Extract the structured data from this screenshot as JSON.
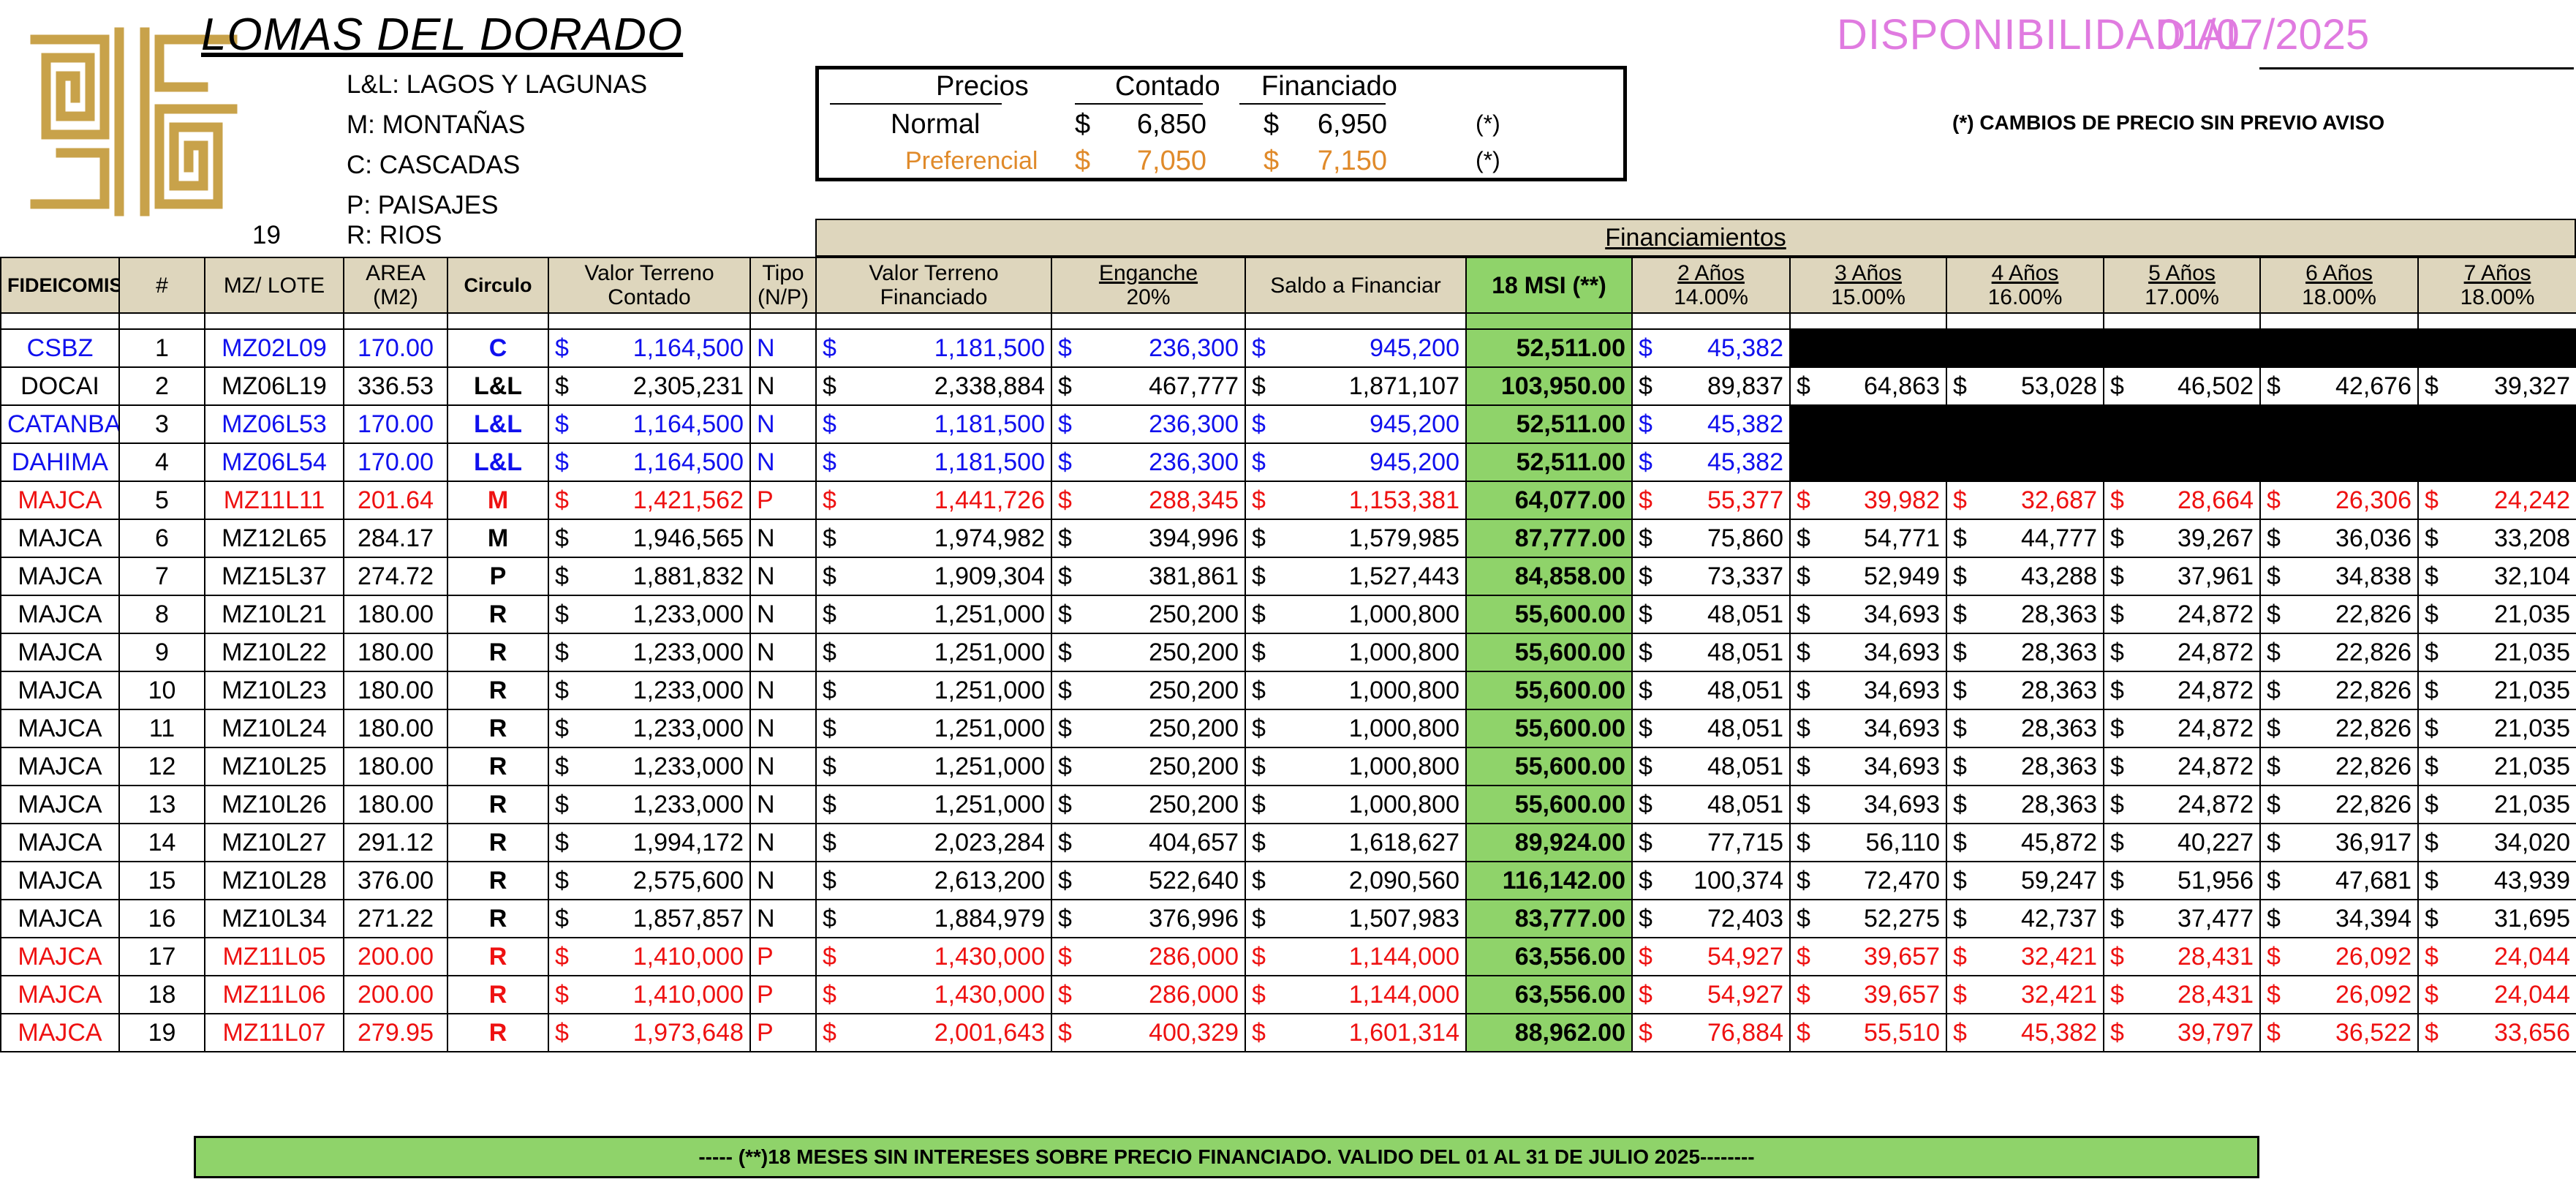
{
  "title": "LOMAS DEL DORADO",
  "legend": [
    "L&L: LAGOS Y LAGUNAS",
    "M: MONTAÑAS",
    "C: CASCADAS",
    "P: PAISAJES",
    "R: RIOS"
  ],
  "lot_count": "19",
  "prices": {
    "col_label": "Precios",
    "col_contado": "Contado",
    "col_financiado": "Financiado",
    "rows": [
      {
        "label": "Normal",
        "contado": "6,850",
        "financiado": "6,950",
        "note": "(*)"
      },
      {
        "label": "Preferencial",
        "contado": "7,050",
        "financiado": "7,150",
        "note": "(*)"
      }
    ],
    "currency": "$"
  },
  "availability": {
    "label": "DISPONIBILIDAD AL",
    "date": "01/07/2025"
  },
  "price_notice": "(*) CAMBIOS DE PRECIO SIN PREVIO AVISO",
  "financing_label": "Financiamientos",
  "colors": {
    "tan": "#ded6bd",
    "green": "#8fd36a",
    "blue": "#1010ee",
    "red": "#ee1111",
    "orange": "#e08a2a",
    "pink": "#e07be0",
    "gold": "#c8a24a"
  },
  "headers": {
    "fideicomiso": "FIDEICOMISO",
    "num": "#",
    "mz_lote": "MZ/ LOTE",
    "area_1": "AREA",
    "area_2": "(M2)",
    "circulo": "Circulo",
    "vt_contado_1": "Valor Terreno",
    "vt_contado_2": "Contado",
    "tipo_1": "Tipo",
    "tipo_2": "(N/P)",
    "vt_fin_1": "Valor Terreno",
    "vt_fin_2": "Financiado",
    "enganche_1": "Enganche",
    "enganche_2": "20%",
    "saldo": "Saldo a Financiar",
    "msi": "18 MSI (**)",
    "years": [
      {
        "label": "2 Años",
        "rate": "14.00%"
      },
      {
        "label": "3 Años",
        "rate": "15.00%"
      },
      {
        "label": "4 Años",
        "rate": "16.00%"
      },
      {
        "label": "5 Años",
        "rate": "17.00%"
      },
      {
        "label": "6 Años",
        "rate": "18.00%"
      },
      {
        "label": "7 Años",
        "rate": "18.00%"
      }
    ]
  },
  "rows": [
    {
      "fid": "CSBZ",
      "n": "1",
      "lote": "MZ02L09",
      "area": "170.00",
      "circ": "C",
      "contado": "1,164,500",
      "tipo": "N",
      "fin": "1,181,500",
      "eng": "236,300",
      "saldo": "945,200",
      "msi": "52,511.00",
      "y": [
        "45,382"
      ],
      "style": "blue"
    },
    {
      "fid": "DOCAI",
      "n": "2",
      "lote": "MZ06L19",
      "area": "336.53",
      "circ": "L&L",
      "contado": "2,305,231",
      "tipo": "N",
      "fin": "2,338,884",
      "eng": "467,777",
      "saldo": "1,871,107",
      "msi": "103,950.00",
      "y": [
        "89,837",
        "64,863",
        "53,028",
        "46,502",
        "42,676",
        "39,327"
      ],
      "style": "normal"
    },
    {
      "fid": "CATANBAR",
      "n": "3",
      "lote": "MZ06L53",
      "area": "170.00",
      "circ": "L&L",
      "contado": "1,164,500",
      "tipo": "N",
      "fin": "1,181,500",
      "eng": "236,300",
      "saldo": "945,200",
      "msi": "52,511.00",
      "y": [
        "45,382"
      ],
      "style": "blue"
    },
    {
      "fid": "DAHIMA",
      "n": "4",
      "lote": "MZ06L54",
      "area": "170.00",
      "circ": "L&L",
      "contado": "1,164,500",
      "tipo": "N",
      "fin": "1,181,500",
      "eng": "236,300",
      "saldo": "945,200",
      "msi": "52,511.00",
      "y": [
        "45,382"
      ],
      "style": "blue"
    },
    {
      "fid": "MAJCA",
      "n": "5",
      "lote": "MZ11L11",
      "area": "201.64",
      "circ": "M",
      "contado": "1,421,562",
      "tipo": "P",
      "fin": "1,441,726",
      "eng": "288,345",
      "saldo": "1,153,381",
      "msi": "64,077.00",
      "y": [
        "55,377",
        "39,982",
        "32,687",
        "28,664",
        "26,306",
        "24,242"
      ],
      "style": "red"
    },
    {
      "fid": "MAJCA",
      "n": "6",
      "lote": "MZ12L65",
      "area": "284.17",
      "circ": "M",
      "contado": "1,946,565",
      "tipo": "N",
      "fin": "1,974,982",
      "eng": "394,996",
      "saldo": "1,579,985",
      "msi": "87,777.00",
      "y": [
        "75,860",
        "54,771",
        "44,777",
        "39,267",
        "36,036",
        "33,208"
      ],
      "style": "normal"
    },
    {
      "fid": "MAJCA",
      "n": "7",
      "lote": "MZ15L37",
      "area": "274.72",
      "circ": "P",
      "contado": "1,881,832",
      "tipo": "N",
      "fin": "1,909,304",
      "eng": "381,861",
      "saldo": "1,527,443",
      "msi": "84,858.00",
      "y": [
        "73,337",
        "52,949",
        "43,288",
        "37,961",
        "34,838",
        "32,104"
      ],
      "style": "normal"
    },
    {
      "fid": "MAJCA",
      "n": "8",
      "lote": "MZ10L21",
      "area": "180.00",
      "circ": "R",
      "contado": "1,233,000",
      "tipo": "N",
      "fin": "1,251,000",
      "eng": "250,200",
      "saldo": "1,000,800",
      "msi": "55,600.00",
      "y": [
        "48,051",
        "34,693",
        "28,363",
        "24,872",
        "22,826",
        "21,035"
      ],
      "style": "normal"
    },
    {
      "fid": "MAJCA",
      "n": "9",
      "lote": "MZ10L22",
      "area": "180.00",
      "circ": "R",
      "contado": "1,233,000",
      "tipo": "N",
      "fin": "1,251,000",
      "eng": "250,200",
      "saldo": "1,000,800",
      "msi": "55,600.00",
      "y": [
        "48,051",
        "34,693",
        "28,363",
        "24,872",
        "22,826",
        "21,035"
      ],
      "style": "normal"
    },
    {
      "fid": "MAJCA",
      "n": "10",
      "lote": "MZ10L23",
      "area": "180.00",
      "circ": "R",
      "contado": "1,233,000",
      "tipo": "N",
      "fin": "1,251,000",
      "eng": "250,200",
      "saldo": "1,000,800",
      "msi": "55,600.00",
      "y": [
        "48,051",
        "34,693",
        "28,363",
        "24,872",
        "22,826",
        "21,035"
      ],
      "style": "normal"
    },
    {
      "fid": "MAJCA",
      "n": "11",
      "lote": "MZ10L24",
      "area": "180.00",
      "circ": "R",
      "contado": "1,233,000",
      "tipo": "N",
      "fin": "1,251,000",
      "eng": "250,200",
      "saldo": "1,000,800",
      "msi": "55,600.00",
      "y": [
        "48,051",
        "34,693",
        "28,363",
        "24,872",
        "22,826",
        "21,035"
      ],
      "style": "normal"
    },
    {
      "fid": "MAJCA",
      "n": "12",
      "lote": "MZ10L25",
      "area": "180.00",
      "circ": "R",
      "contado": "1,233,000",
      "tipo": "N",
      "fin": "1,251,000",
      "eng": "250,200",
      "saldo": "1,000,800",
      "msi": "55,600.00",
      "y": [
        "48,051",
        "34,693",
        "28,363",
        "24,872",
        "22,826",
        "21,035"
      ],
      "style": "normal"
    },
    {
      "fid": "MAJCA",
      "n": "13",
      "lote": "MZ10L26",
      "area": "180.00",
      "circ": "R",
      "contado": "1,233,000",
      "tipo": "N",
      "fin": "1,251,000",
      "eng": "250,200",
      "saldo": "1,000,800",
      "msi": "55,600.00",
      "y": [
        "48,051",
        "34,693",
        "28,363",
        "24,872",
        "22,826",
        "21,035"
      ],
      "style": "normal"
    },
    {
      "fid": "MAJCA",
      "n": "14",
      "lote": "MZ10L27",
      "area": "291.12",
      "circ": "R",
      "contado": "1,994,172",
      "tipo": "N",
      "fin": "2,023,284",
      "eng": "404,657",
      "saldo": "1,618,627",
      "msi": "89,924.00",
      "y": [
        "77,715",
        "56,110",
        "45,872",
        "40,227",
        "36,917",
        "34,020"
      ],
      "style": "normal"
    },
    {
      "fid": "MAJCA",
      "n": "15",
      "lote": "MZ10L28",
      "area": "376.00",
      "circ": "R",
      "contado": "2,575,600",
      "tipo": "N",
      "fin": "2,613,200",
      "eng": "522,640",
      "saldo": "2,090,560",
      "msi": "116,142.00",
      "y": [
        "100,374",
        "72,470",
        "59,247",
        "51,956",
        "47,681",
        "43,939"
      ],
      "style": "normal"
    },
    {
      "fid": "MAJCA",
      "n": "16",
      "lote": "MZ10L34",
      "area": "271.22",
      "circ": "R",
      "contado": "1,857,857",
      "tipo": "N",
      "fin": "1,884,979",
      "eng": "376,996",
      "saldo": "1,507,983",
      "msi": "83,777.00",
      "y": [
        "72,403",
        "52,275",
        "42,737",
        "37,477",
        "34,394",
        "31,695"
      ],
      "style": "normal"
    },
    {
      "fid": "MAJCA",
      "n": "17",
      "lote": "MZ11L05",
      "area": "200.00",
      "circ": "R",
      "contado": "1,410,000",
      "tipo": "P",
      "fin": "1,430,000",
      "eng": "286,000",
      "saldo": "1,144,000",
      "msi": "63,556.00",
      "y": [
        "54,927",
        "39,657",
        "32,421",
        "28,431",
        "26,092",
        "24,044"
      ],
      "style": "red"
    },
    {
      "fid": "MAJCA",
      "n": "18",
      "lote": "MZ11L06",
      "area": "200.00",
      "circ": "R",
      "contado": "1,410,000",
      "tipo": "P",
      "fin": "1,430,000",
      "eng": "286,000",
      "saldo": "1,144,000",
      "msi": "63,556.00",
      "y": [
        "54,927",
        "39,657",
        "32,421",
        "28,431",
        "26,092",
        "24,044"
      ],
      "style": "red"
    },
    {
      "fid": "MAJCA",
      "n": "19",
      "lote": "MZ11L07",
      "area": "279.95",
      "circ": "R",
      "contado": "1,973,648",
      "tipo": "P",
      "fin": "2,001,643",
      "eng": "400,329",
      "saldo": "1,601,314",
      "msi": "88,962.00",
      "y": [
        "76,884",
        "55,510",
        "45,382",
        "39,797",
        "36,522",
        "33,656"
      ],
      "style": "red"
    }
  ],
  "footer_note": "----- (**)18 MESES SIN INTERESES SOBRE PRECIO FINANCIADO. VALIDO DEL 01 AL 31 DE JULIO 2025--------"
}
